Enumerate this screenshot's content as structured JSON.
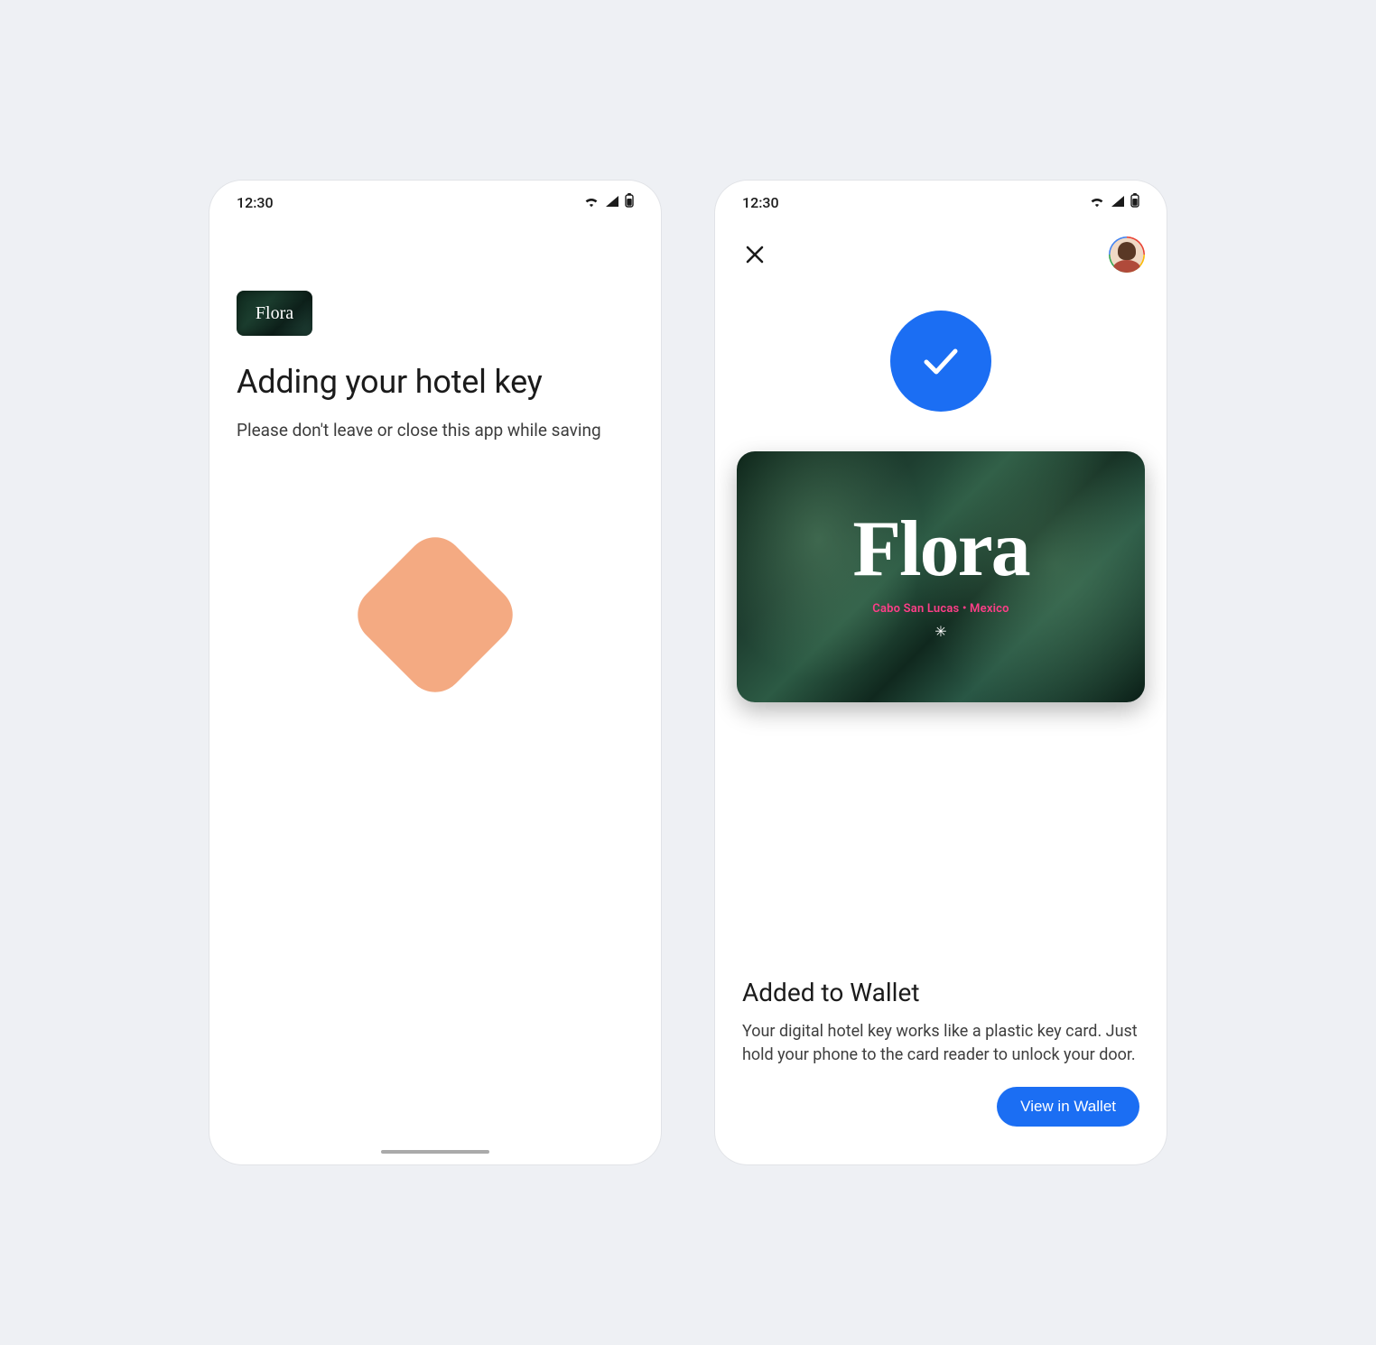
{
  "status": {
    "time": "12:30"
  },
  "left": {
    "brand": "Flora",
    "title": "Adding your hotel key",
    "subtitle": "Please don't leave or close this app while saving"
  },
  "right": {
    "brand": "Flora",
    "brand_location": "Cabo San Lucas  •  Mexico",
    "added_title": "Added to Wallet",
    "added_desc": "Your digital hotel key works like a plastic key card. Just hold your phone to the card reader to unlock your door.",
    "view_button": "View in Wallet"
  }
}
